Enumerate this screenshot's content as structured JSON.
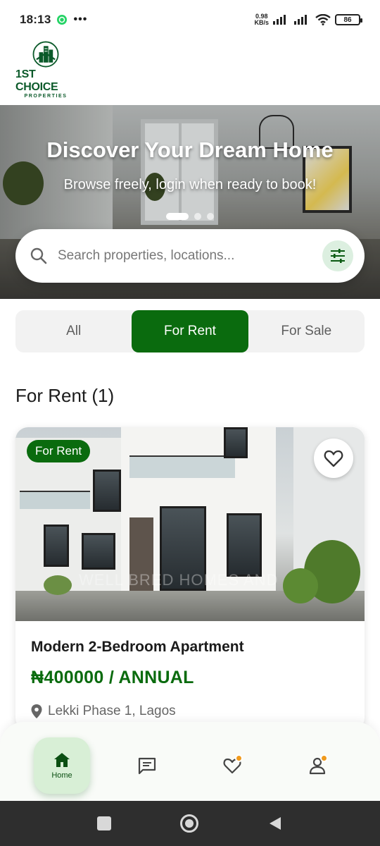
{
  "status_bar": {
    "time": "18:13",
    "net_speed_value": "0.98",
    "net_speed_unit": "KB/s",
    "battery": "86"
  },
  "logo": {
    "title": "1ST CHOICE",
    "subtitle": "PROPERTIES"
  },
  "hero": {
    "title": "Discover Your Dream Home",
    "subtitle": "Browse freely, login when ready to book!",
    "slide_count": 3,
    "active_slide": 1
  },
  "search": {
    "placeholder": "Search properties, locations..."
  },
  "tabs": [
    {
      "label": "All",
      "active": false
    },
    {
      "label": "For Rent",
      "active": true
    },
    {
      "label": "For Sale",
      "active": false
    }
  ],
  "section_title": "For Rent (1)",
  "listing": {
    "badge": "For Rent",
    "title": "Modern 2-Bedroom Apartment",
    "price": "₦400000 / ANNUAL",
    "location": "Lekki Phase 1, Lagos",
    "watermark": "WELL BRED HOMES AND"
  },
  "bottom_nav": {
    "home_label": "Home"
  },
  "colors": {
    "primary_green": "#0a6b0e",
    "logo_green": "#0b5a2a",
    "notification_orange": "#f09a1c"
  }
}
